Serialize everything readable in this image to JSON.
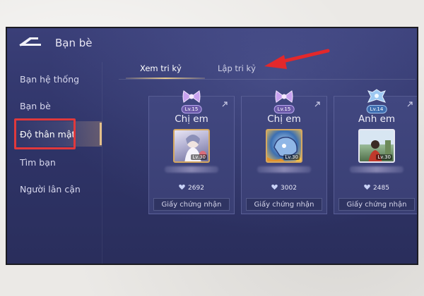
{
  "header": {
    "title": "Bạn bè"
  },
  "sidebar": {
    "items": [
      {
        "label": "Bạn hệ thống"
      },
      {
        "label": "Bạn bè"
      },
      {
        "label": "Độ thân mật"
      },
      {
        "label": "Tìm bạn"
      },
      {
        "label": "Người lân cận"
      }
    ],
    "active_index": 2
  },
  "tabs": [
    {
      "label": "Xem tri kỷ",
      "active": true
    },
    {
      "label": "Lập tri kỷ",
      "active": false
    }
  ],
  "cards": [
    {
      "level": "Lv.15",
      "type": "Chị em",
      "avatar_level": "Lv.30",
      "score": "2692",
      "button": "Giấy chứng nhận"
    },
    {
      "level": "Lv.15",
      "type": "Chị em",
      "avatar_level": "Lv.30",
      "score": "3002",
      "button": "Giấy chứng nhận"
    },
    {
      "level": "Lv.14",
      "type": "Anh em",
      "avatar_level": "Lv.30",
      "score": "2485",
      "button": "Giấy chứng nhận"
    }
  ],
  "colors": {
    "highlight": "#e0393c",
    "arrow": "#e3282b",
    "accent": "#e6c88c"
  }
}
